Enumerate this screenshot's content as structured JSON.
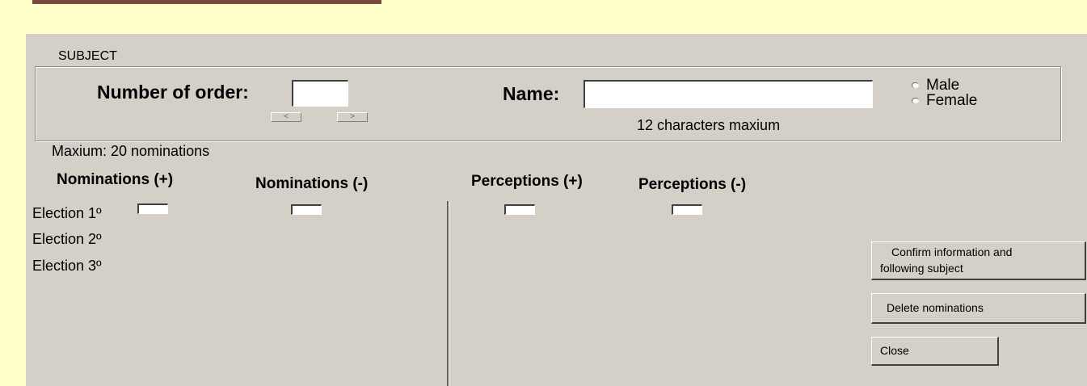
{
  "subject": {
    "legend": "SUBJECT",
    "order_label": "Number of order:",
    "order_value": "",
    "prev_glyph": "<",
    "next_glyph": ">",
    "name_label": "Name:",
    "name_value": "",
    "name_hint": "12 characters maxium",
    "gender": [
      {
        "label": "Male",
        "checked": false
      },
      {
        "label": "Female",
        "checked": false
      }
    ]
  },
  "max_note": "Maxium: 20 nominations",
  "columns": [
    "Nominations (+)",
    "Nominations (-)",
    "Perceptions (+)",
    "Perceptions (-)"
  ],
  "elections": [
    "Election 1º",
    "Election 2º",
    "Election 3º"
  ],
  "buttons": {
    "confirm_line1": "Confirm information and",
    "confirm_line2": "following subject",
    "delete": "Delete nominations",
    "close": "Close"
  },
  "colors": {
    "window_bg": "#ffffcc",
    "panel_bg": "#d4d0c8",
    "title_bar": "#7a4a3c"
  }
}
